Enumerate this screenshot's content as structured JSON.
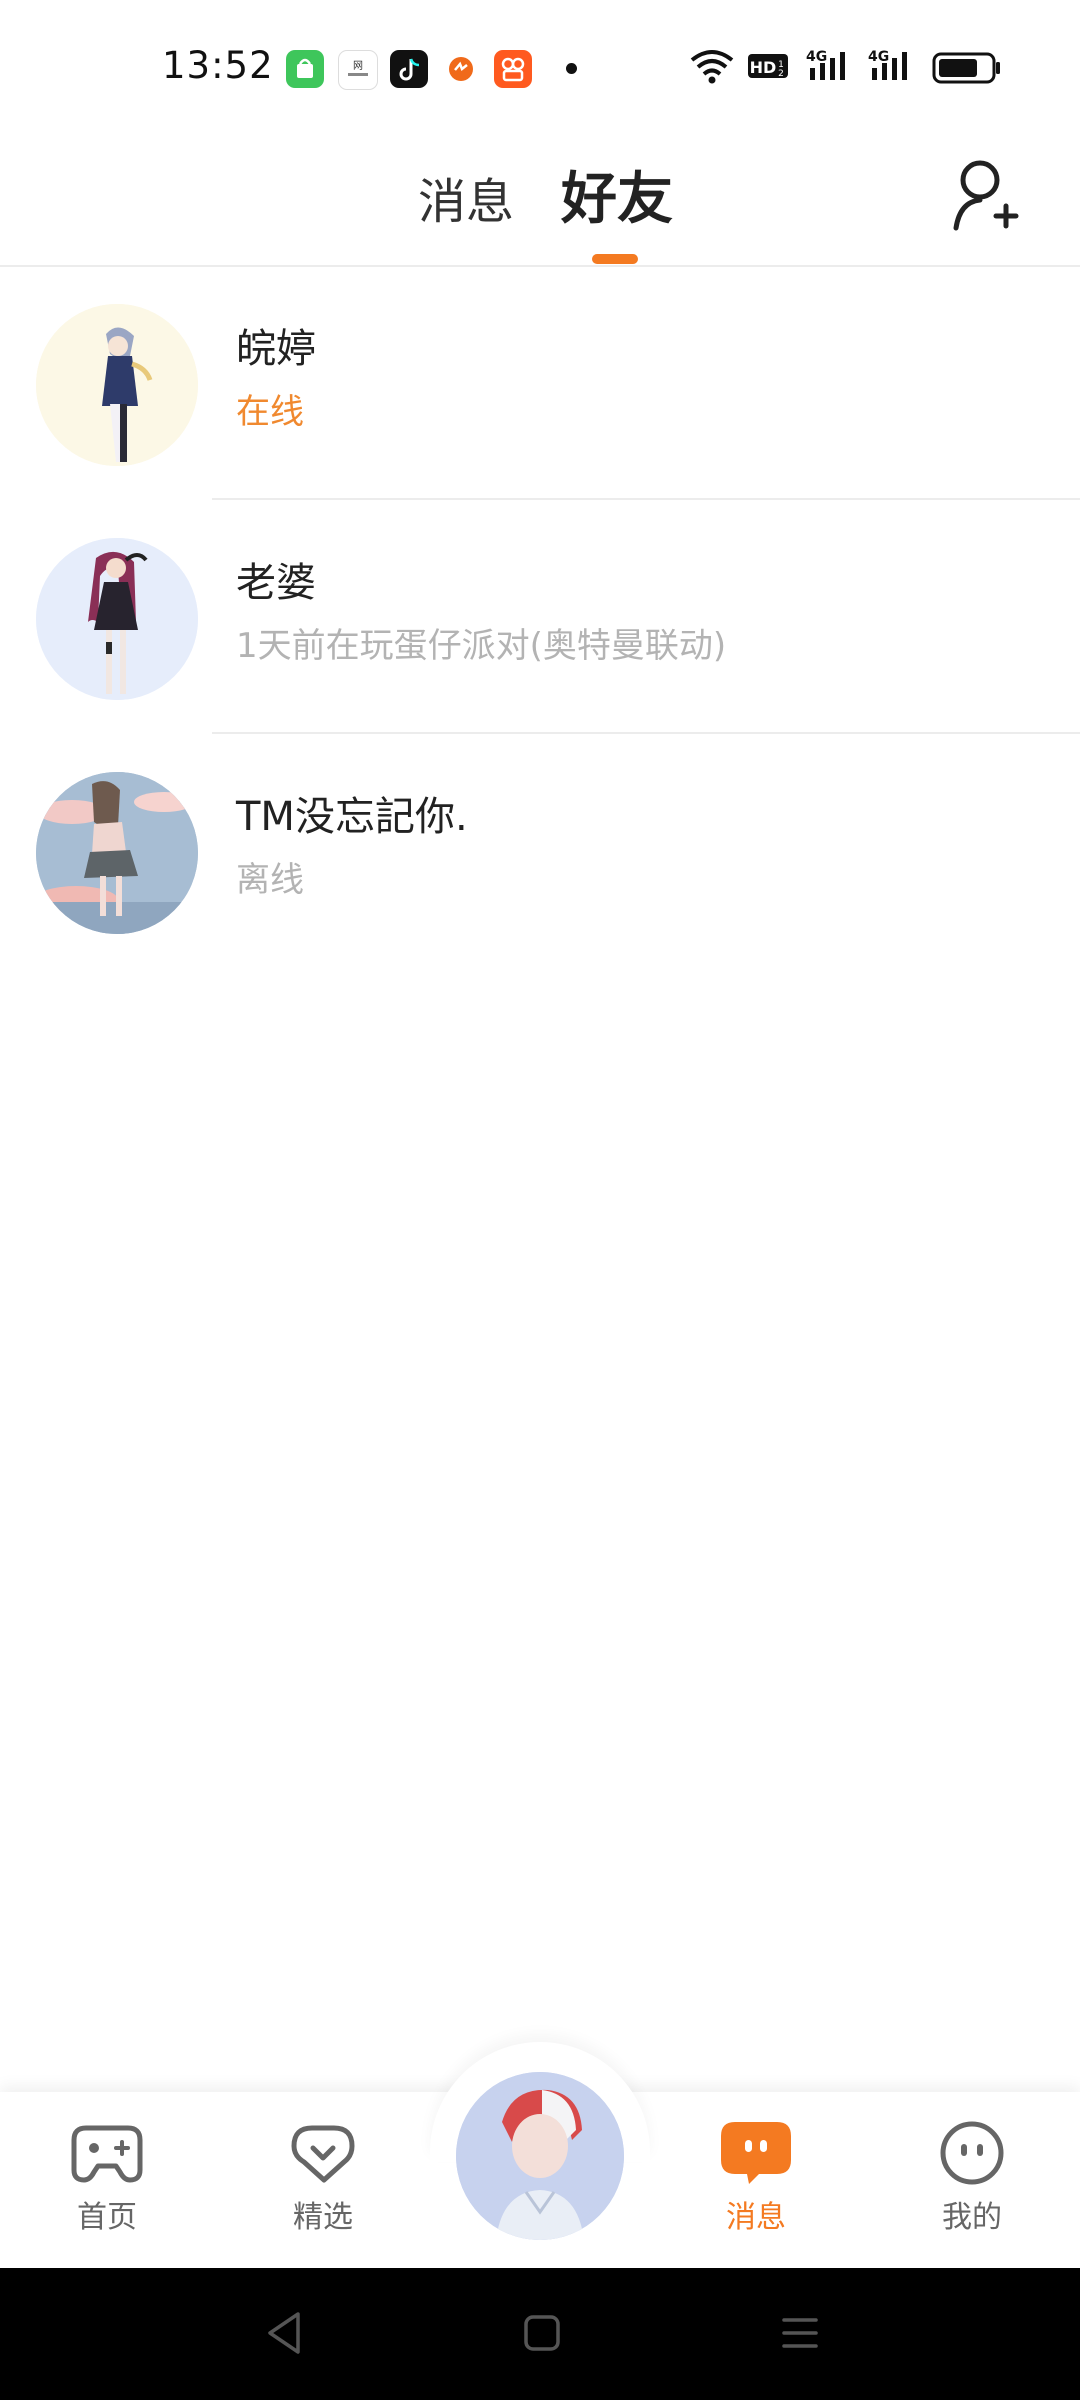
{
  "status_bar": {
    "time": "13:52",
    "app_icons": [
      "market-icon",
      "news-icon",
      "tiktok-icon",
      "sports-icon",
      "kuaishou-icon"
    ],
    "network": [
      "wifi-icon",
      "hd-icon",
      "4g-signal-icon",
      "4g-signal-icon"
    ],
    "hd_label": "HD",
    "net_label": "4G"
  },
  "header": {
    "tabs": [
      {
        "label": "消息",
        "active": false
      },
      {
        "label": "好友",
        "active": true
      }
    ],
    "accent_color": "#f47a21"
  },
  "friends": [
    {
      "name": "皖婷",
      "status": "在线",
      "online": true
    },
    {
      "name": "老婆",
      "status": "1天前在玩蛋仔派对(奥特曼联动)",
      "online": false
    },
    {
      "name": "TM没忘記你.",
      "status": "离线",
      "online": false
    }
  ],
  "bottom_nav": {
    "items": [
      {
        "label": "首页",
        "icon": "gamepad-icon",
        "active": false
      },
      {
        "label": "精选",
        "icon": "heart-badge-icon",
        "active": false
      },
      {
        "label": "消息",
        "icon": "chat-face-icon",
        "active": true
      },
      {
        "label": "我的",
        "icon": "face-icon",
        "active": false
      }
    ]
  }
}
